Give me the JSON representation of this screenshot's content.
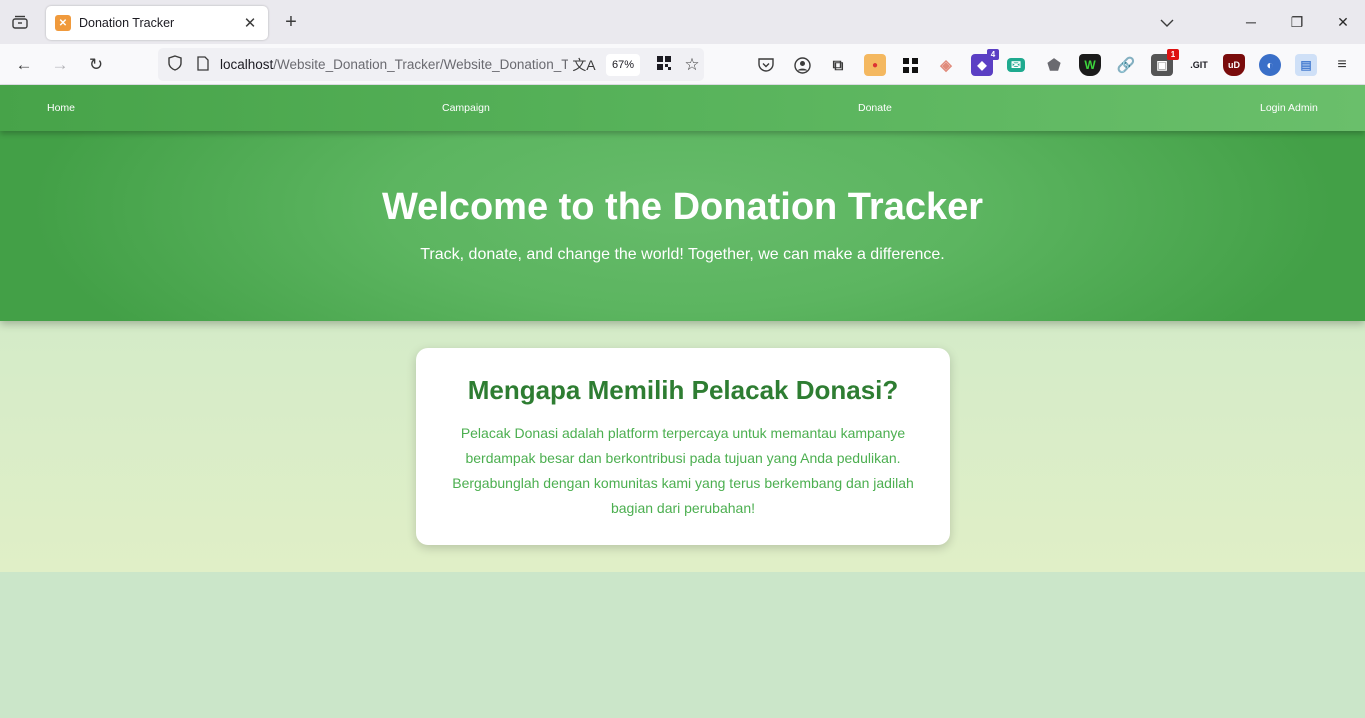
{
  "browser": {
    "tab": {
      "title": "Donation Tracker",
      "favicon": "xampp-icon"
    },
    "url": {
      "host": "localhost",
      "path": "/Website_Donation_Tracker/Website_Donation_T"
    },
    "zoom": "67%",
    "extensions": [
      {
        "name": "pocket-icon",
        "badge": ""
      },
      {
        "name": "account-icon",
        "badge": ""
      },
      {
        "name": "extensions-icon",
        "badge": ""
      },
      {
        "name": "extension-burger-icon",
        "badge": ""
      },
      {
        "name": "extension-grid-icon",
        "badge": ""
      },
      {
        "name": "extension-diamond-icon",
        "badge": ""
      },
      {
        "name": "extension-purple-icon",
        "badge": "4"
      },
      {
        "name": "extension-mail-icon",
        "badge": ""
      },
      {
        "name": "extension-puzzle-icon",
        "badge": ""
      },
      {
        "name": "extension-shield-w-icon",
        "badge": ""
      },
      {
        "name": "extension-link-icon",
        "badge": ""
      },
      {
        "name": "extension-notify-icon",
        "badge": "1"
      },
      {
        "name": "extension-git-icon",
        "badge": ""
      },
      {
        "name": "ublock-icon",
        "badge": ""
      },
      {
        "name": "extension-globe-icon",
        "badge": ""
      },
      {
        "name": "extension-page-icon",
        "badge": ""
      }
    ]
  },
  "site": {
    "nav": {
      "home": "Home",
      "campaign": "Campaign",
      "donate": "Donate",
      "login": "Login Admin"
    },
    "hero": {
      "title": "Welcome to the Donation Tracker",
      "subtitle": "Track, donate, and change the world! Together, we can make a difference."
    },
    "card": {
      "title": "Mengapa Memilih Pelacak Donasi?",
      "body": "Pelacak Donasi adalah platform terpercaya untuk memantau kampanye berdampak besar dan berkontribusi pada tujuan yang Anda pedulikan. Bergabunglah dengan komunitas kami yang terus berkembang dan jadilah bagian dari perubahan!"
    },
    "colors": {
      "nav_green": "#4caf50",
      "hero_green": "#5cb560",
      "heading_green": "#2e7d32",
      "text_green": "#4caf50",
      "page_bg": "#cbe6c9"
    }
  }
}
